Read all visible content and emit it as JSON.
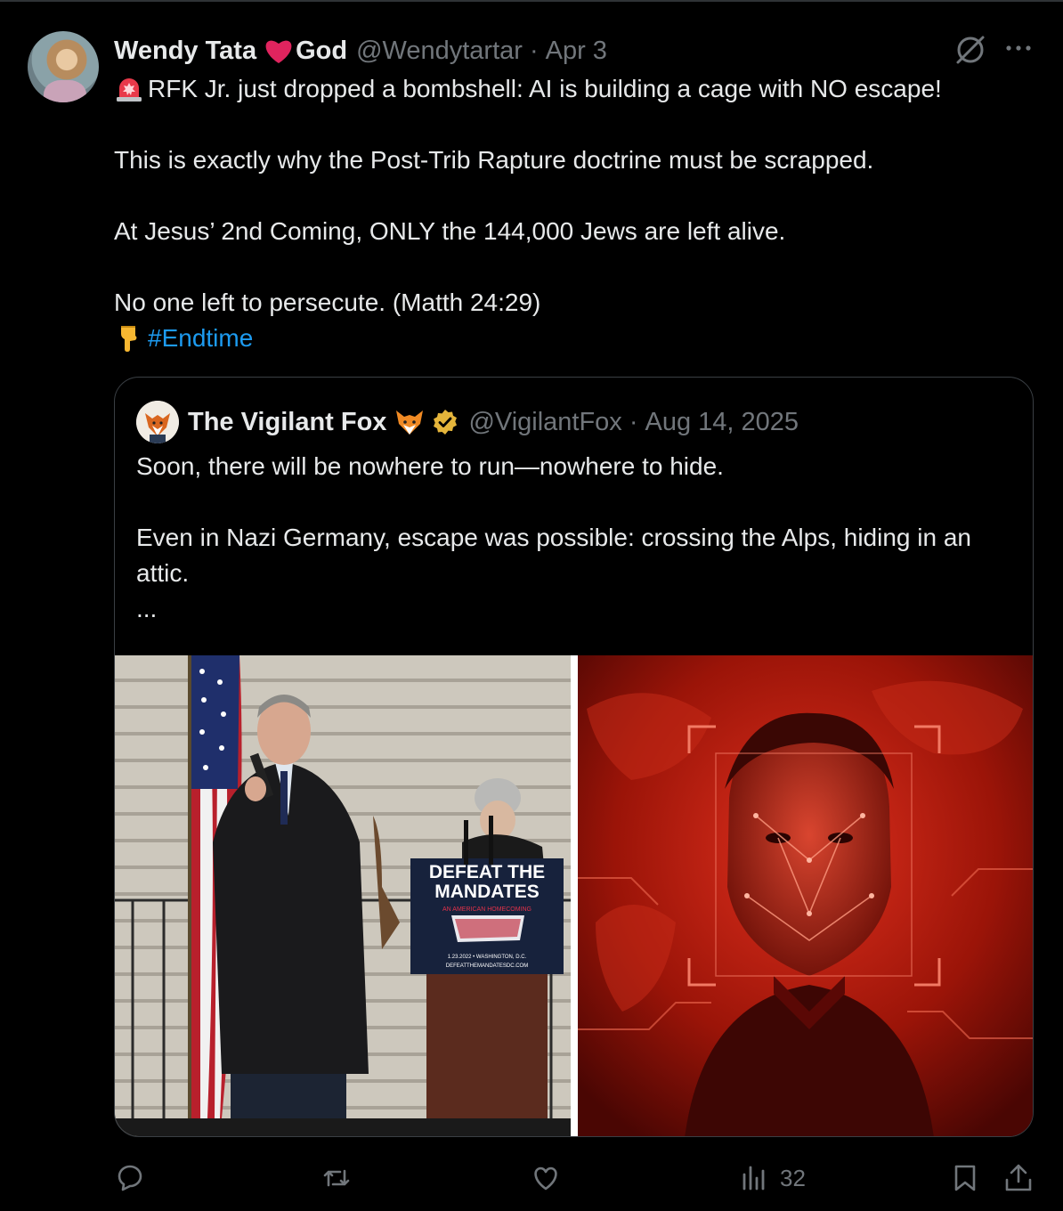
{
  "tweet": {
    "author_name": "Wendy Tata",
    "author_name_suffix": "God",
    "handle": "@Wendytartar",
    "separator": "·",
    "date": "Apr 3",
    "lines": [
      "RFK Jr. just dropped a bombshell: AI is building a cage with NO escape!",
      "This is exactly why the Post-Trib Rapture doctrine must be scrapped.",
      "At Jesus’ 2nd Coming, ONLY the 144,000 Jews are left alive.",
      "No one left to persecute. (Matth 24:29)"
    ],
    "hashtag": "#Endtime",
    "lead_emoji": "rotating-light-icon",
    "hashtag_emoji": "pointing-down-icon"
  },
  "quote": {
    "author_name": "The Vigilant Fox",
    "handle": "@VigilantFox",
    "separator": "·",
    "date": "Aug 14, 2025",
    "lines": [
      "Soon, there will be nowhere to run—nowhere to hide.",
      "Even in Nazi Germany, escape was possible: crossing the Alps, hiding in an attic.",
      "..."
    ],
    "photo_left": {
      "podium_line1": "DEFEAT THE",
      "podium_line2": "MANDATES",
      "podium_line3": "AN AMERICAN HOMECOMING",
      "podium_line4": "1.23.2022 • WASHINGTON, D.C.",
      "podium_line5": "DEFEATTHEMANDATESDC.COM"
    }
  },
  "actions": {
    "views_count": "32"
  },
  "colors": {
    "background": "#000000",
    "text": "#e7e9ea",
    "muted": "#71767b",
    "link": "#1d9bf0",
    "border": "#3a3f44"
  }
}
